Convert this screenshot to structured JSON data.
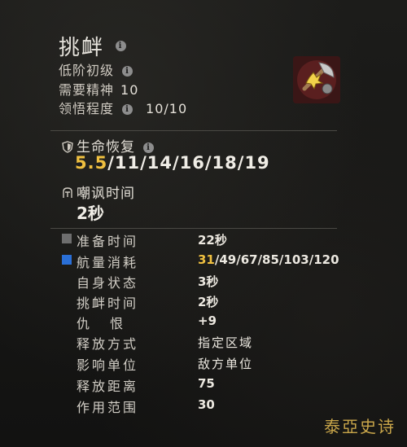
{
  "skill": {
    "name": "挑衅",
    "tier": "低阶初级",
    "requirement_label": "需要精神",
    "requirement_value": "10",
    "mastery_label": "领悟程度",
    "mastery_value": "10/10"
  },
  "sections": {
    "heal_label": "生命恢复",
    "heal_highlight": "5.5",
    "heal_rest": "/11/14/16/18/19",
    "taunt_label": "嘲讽时间",
    "taunt_value": "2秒"
  },
  "stats": [
    {
      "label": "准备时间",
      "value": "22秒"
    },
    {
      "label": "航量消耗",
      "value_highlight": "31",
      "value_rest": "/49/67/85/103/120"
    },
    {
      "label": "自身状态",
      "value": "3秒"
    },
    {
      "label": "挑衅时间",
      "value": "2秒"
    },
    {
      "label": "仇 恨",
      "value": "+9"
    },
    {
      "label": "释放方式",
      "value": "指定区域"
    },
    {
      "label": "影响单位",
      "value": "敌方单位"
    },
    {
      "label": "释放距离",
      "value": "75"
    },
    {
      "label": "作用范围",
      "value": "30"
    }
  ],
  "watermark": "泰亞史诗",
  "icons": {
    "info": "info-icon",
    "skill": "axe-skill-icon",
    "shield": "shield-icon",
    "helmet": "helmet-icon"
  },
  "colors": {
    "highlight": "#f0c040",
    "energy_square": "#2a6fd6",
    "time_square": "#6e6e6e"
  }
}
